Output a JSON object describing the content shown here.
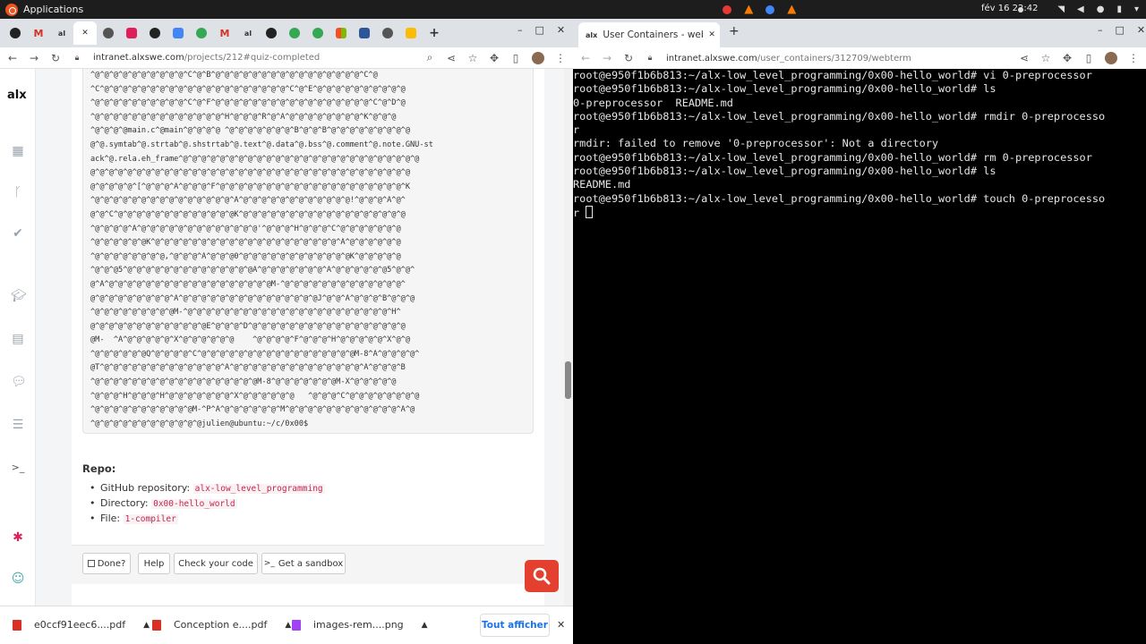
{
  "system": {
    "apps_label": "Applications",
    "clock": "fév 16  22:42"
  },
  "left": {
    "url_host": "intranet.alxswe.com",
    "url_path": "/projects/212#quiz-completed",
    "logo": "alx",
    "code_lines": [
      "^@^@^@^@^@^@^@^@^@^@^C^@^B^@^@^@^@^@^@^@^@^@^@^@^@^@^@^@^@^C^@",
      "^C^@^@^@^@^@^@^@^@^@^@^@^@^@^@^@^@^@^@^@^@^C^@^E^@^@^@^@^@^@^@^@^@^@",
      "^@^@^@^@^@^@^@^@^@^@^C^@^F^@^@^@^@^@^@^@^@^@^@^@^@^@^@^@^@^@^C^@^D^@",
      "^@^@^@^@^@^@^@^@^@^@^@^@^@^@^H^@^@^@^R^@^A^@^@^@^@^@^@^@^@^K^@^@^@",
      "^@^@^@^@main.c^@main^@^@^@^@ ^@^@^@^@^@^@^@^B^@^@^B^@^@^@^@^@^@^@^@^@",
      "@^@.symtab^@.strtab^@.shstrtab^@.text^@.data^@.bss^@.comment^@.note.GNU-st",
      "ack^@.rela.eh_frame^@^@^@^@^@^@^@^@^@^@^@^@^@^@^@^@^@^@^@^@^@^@^@^@^@^@",
      "@^@^@^@^@^@^@^@^@^@^@^@^@^@^@^@^@^@^@^@^@^@^@^@^@^@^@^@^@^@^@^@^@^@^@",
      "@^@^@^@^@^[^@^@^@^A^@^@^@^F^@^@^@^@^@^@^@^@^@^@^@^@^@^@^@^@^@^@^@^@^K",
      "^@^@^@^@^@^@^@^@^@^@^@^@^@^@^@^A^@^@^@^@^@^@^@^@^@^@^@^@!^@^@^@^A^@^",
      "@^@^C^@^@^@^@^@^@^@^@^@^@^@^@^@K^@^@^@^@^@^@^@^@^@^@^@^@^@^@^@^@^@^@",
      "^@^@^@^@^A^@^@^@^@^@^@^@^@^@^@^@^@^@'^@^@^@^H^@^@^@^C^@^@^@^@^@^@^@",
      "^@^@^@^@^@^@K^@^@^@^@^@^@^@^@^@^@^@^@^@^@^@^@^@^@^@^@^A^@^@^@^@^@^@",
      "^@^@^@^@^@^@^@^@,^@^@^@^A^@^@^@0^@^@^@^@^@^@^@^@^@^@^@^@K^@^@^@^@^@",
      "^@^@^@5^@^@^@^@^@^@^@^@^@^@^@^@^@^@A^@^@^@^@^@^@^@^A^@^@^@^@^@^@5^@^@^",
      "@^A^@^@^@^@^@^@^@^@^@^@^@^@^@^@^@^@^@^@M-^@^@^@^@^@^@^@^@^@^@^@^@^@^",
      "@^@^@^@^@^@^@^@^@^A^@^@^@^@^@^@^@^@^@^@^@^@^@^@^@J^@^@^A^@^@^@^B^@^@^@",
      "^@^@^@^@^@^@^@^@^@M-^@^@^@^@^@^@^@^@^@^@^@^@^@^@^@^@^@^@^@^@^@^@^H^",
      "@^@^@^@^@^@^@^@^@^@^@^@^@E^@^@^@^D^@^@^@^@^@^@^@^@^@^@^@^@^@^@^@^@^@",
      "@M-  ^A^@^@^@^@^@^X^@^@^@^@^@^@    ^@^@^@^@^F^@^@^@^H^@^@^@^@^@^X^@^@",
      "^@^@^@^@^@^@Q^@^@^@^@^C^@^@^@^@^@^@^@^@^@^@^@^@^@^@^@^@^@M-8^A^@^@^@^@^",
      "@T^@^@^@^@^@^@^@^@^@^@^@^@^@^A^@^@^@^@^@^@^@^@^@^@^@^@^@^@^A^@^@^@^B",
      "^@^@^@^@^@^@^@^@^@^@^@^@^@^@^@^@^@^@M-8^@^@^@^@^@^@^@M-X^@^@^@^@^@",
      "^@^@^@^H^@^@^@^H^@^@^@^@^@^@^@^X^@^@^@^@^@^@   ^@^@^@^C^@^@^@^@^@^@^@^@",
      "^@^@^@^@^@^@^@^@^@^@^@M-^P^A^@^@^@^@^@^@^M^@^@^@^@^@^@^@^@^@^@^@^@^A^@",
      "^@^@^@^@^@^@^@^@^@^@^@^@julien@ubuntu:~/c/0x00$"
    ],
    "repo": {
      "title": "Repo:",
      "github_label": "GitHub repository: ",
      "github_value": "alx-low_level_programming",
      "dir_label": "Directory: ",
      "dir_value": "0x00-hello_world",
      "file_label": "File: ",
      "file_value": "1-compiler"
    },
    "buttons": {
      "done": "Done?",
      "help": "Help",
      "check": "Check your code",
      "sandbox": "Get a sandbox"
    },
    "downloads": {
      "item1": "e0ccf91eec6....pdf",
      "item2": "Conception e....pdf",
      "item3": "images-rem....png",
      "show_all": "Tout afficher"
    }
  },
  "right": {
    "tab_title": "User Containers - webterm",
    "url_host": "intranet.alxswe.com",
    "url_path": "/user_containers/312709/webterm",
    "terminal_lines": [
      "root@e950f1b6b813:~/alx-low_level_programming/0x00-hello_world# vi 0-preprocessor",
      "root@e950f1b6b813:~/alx-low_level_programming/0x00-hello_world# ls",
      "0-preprocessor  README.md",
      "root@e950f1b6b813:~/alx-low_level_programming/0x00-hello_world# rmdir 0-preprocesso",
      "r",
      "rmdir: failed to remove '0-preprocessor': Not a directory",
      "root@e950f1b6b813:~/alx-low_level_programming/0x00-hello_world# rm 0-preprocessor",
      "root@e950f1b6b813:~/alx-low_level_programming/0x00-hello_world# ls",
      "README.md",
      "root@e950f1b6b813:~/alx-low_level_programming/0x00-hello_world# touch 0-preprocesso"
    ],
    "terminal_last": "r "
  },
  "colors": {
    "accent_red": "#e4402f",
    "link_blue": "#1a73e8",
    "terminal_bg": "#000000"
  }
}
